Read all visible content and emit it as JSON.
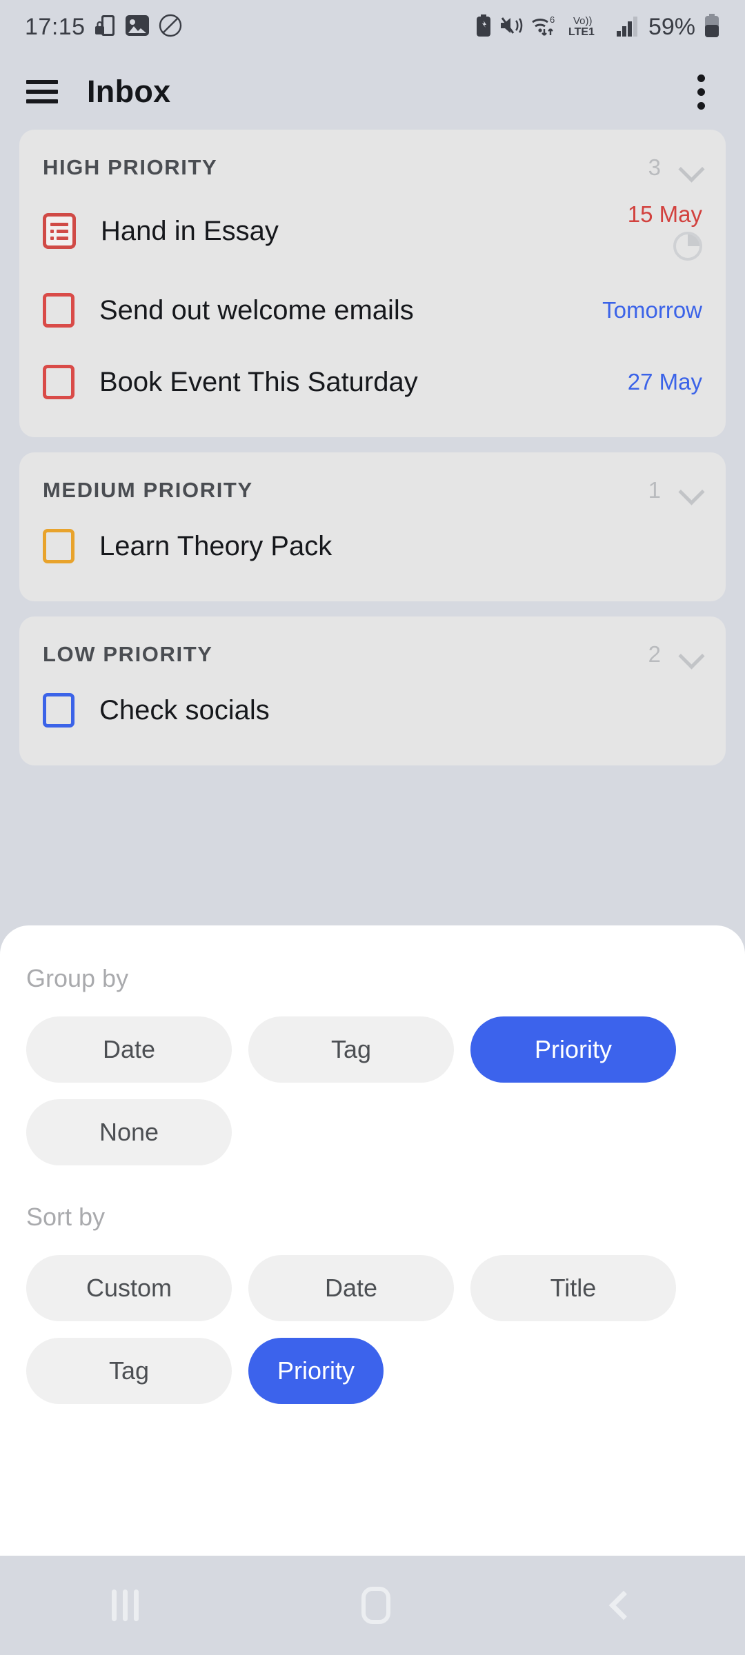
{
  "status_bar": {
    "time": "17:15",
    "battery_percent": "59%",
    "left_icons": [
      "phone-lock-icon",
      "gallery-icon",
      "dnd-icon"
    ],
    "right_icons": [
      "battery-saver-icon",
      "mute-vibrate-icon",
      "wifi-6-icon",
      "volte-lte1-icon",
      "signal-bars-icon",
      "battery-icon"
    ],
    "network_label": "Vo))",
    "network_sub": "LTE1",
    "wifi_gen": "6"
  },
  "app_bar": {
    "title": "Inbox",
    "menu_icon": "hamburger-icon",
    "overflow_icon": "kebab-menu-icon"
  },
  "sections": [
    {
      "title": "HIGH PRIORITY",
      "count": "3",
      "tasks": [
        {
          "title": "Hand in Essay",
          "date": "15 May",
          "date_color": "red",
          "box": "subtask",
          "box_color": "red",
          "progress": true
        },
        {
          "title": "Send out welcome emails",
          "date": "Tomorrow",
          "date_color": "blue",
          "box": "checkbox",
          "box_color": "red",
          "progress": false
        },
        {
          "title": "Book Event This Saturday",
          "date": "27 May",
          "date_color": "blue",
          "box": "checkbox",
          "box_color": "red",
          "progress": false
        }
      ]
    },
    {
      "title": "MEDIUM PRIORITY",
      "count": "1",
      "tasks": [
        {
          "title": "Learn Theory Pack",
          "date": "",
          "date_color": "",
          "box": "checkbox",
          "box_color": "amber",
          "progress": false
        }
      ]
    },
    {
      "title": "LOW PRIORITY",
      "count": "2",
      "tasks": [
        {
          "title": "Check socials",
          "date": "",
          "date_color": "",
          "box": "checkbox",
          "box_color": "blue",
          "progress": false
        }
      ]
    }
  ],
  "sheet": {
    "group_by_label": "Group by",
    "group_by_options": [
      {
        "label": "Date",
        "selected": false
      },
      {
        "label": "Tag",
        "selected": false
      },
      {
        "label": "Priority",
        "selected": true
      },
      {
        "label": "None",
        "selected": false
      }
    ],
    "sort_by_label": "Sort by",
    "sort_by_options": [
      {
        "label": "Custom",
        "selected": false
      },
      {
        "label": "Date",
        "selected": false
      },
      {
        "label": "Title",
        "selected": false
      },
      {
        "label": "Tag",
        "selected": false
      },
      {
        "label": "Priority",
        "selected": true
      }
    ]
  },
  "nav_bar": {
    "recents": "recents-icon",
    "home": "home-icon",
    "back": "back-icon"
  },
  "colors": {
    "accent": "#3c63ec",
    "high": "#d94b48",
    "medium": "#e8a32c",
    "low": "#3b63e8",
    "page_bg": "#d6d9e0",
    "card_bg": "#e5e5e5"
  }
}
